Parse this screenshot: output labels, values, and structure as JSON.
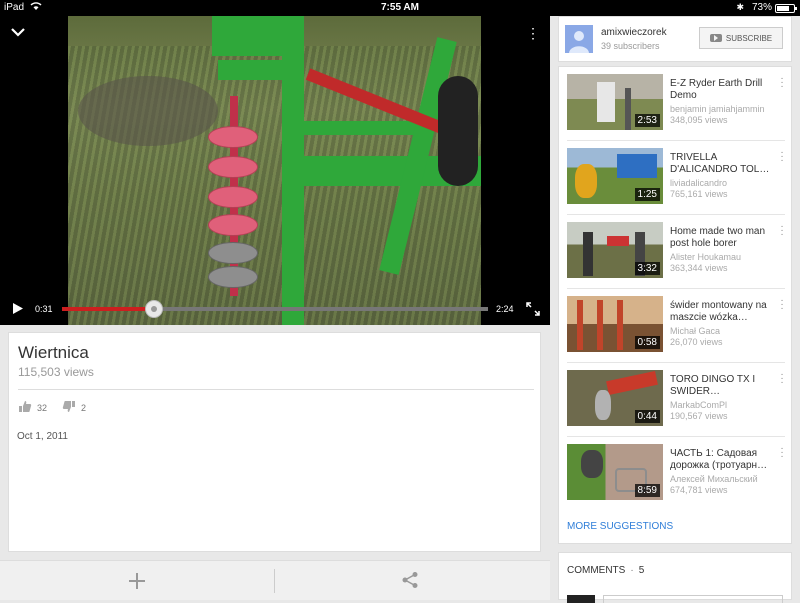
{
  "status_bar": {
    "device": "iPad",
    "time": "7:55 AM",
    "battery": "73%"
  },
  "player": {
    "current_time": "0:31",
    "duration": "2:24",
    "progress": 0.215,
    "buffered": 0.215
  },
  "video": {
    "title": "Wiertnica",
    "views": "115,503 views",
    "likes": "32",
    "dislikes": "2",
    "date": "Oct 1, 2011"
  },
  "channel": {
    "name": "amixwieczorek",
    "subscribers": "39 subscribers",
    "subscribe_label": "SUBSCRIBE"
  },
  "suggestions": [
    {
      "title": "E-Z Ryder Earth Drill Demo",
      "author": "benjamin jamiahjammin",
      "views": "348,095 views",
      "duration": "2:53"
    },
    {
      "title": "TRIVELLA D'ALICANDRO TOL…",
      "author": "liviadalicandro",
      "views": "765,161 views",
      "duration": "1:25"
    },
    {
      "title": "Home made two man post hole borer",
      "author": "Alister Houkamau",
      "views": "363,344 views",
      "duration": "3:32"
    },
    {
      "title": "świder montowany na maszcie wózka…",
      "author": "Michał Gaca",
      "views": "26,070 views",
      "duration": "0:58"
    },
    {
      "title": "TORO DINGO TX I SWIDER…",
      "author": "MarkabComPl",
      "views": "190,567 views",
      "duration": "0:44"
    },
    {
      "title": "ЧАСТЬ 1: Садовая дорожка (тротуарн…",
      "author": "Алексей Михальский",
      "views": "674,781 views",
      "duration": "8:59"
    }
  ],
  "more_suggestions_label": "MORE SUGGESTIONS",
  "comments": {
    "label": "COMMENTS",
    "count": "5"
  },
  "colors": {
    "accent_red": "#cc1f1f",
    "link_blue": "#2f7ed8"
  }
}
